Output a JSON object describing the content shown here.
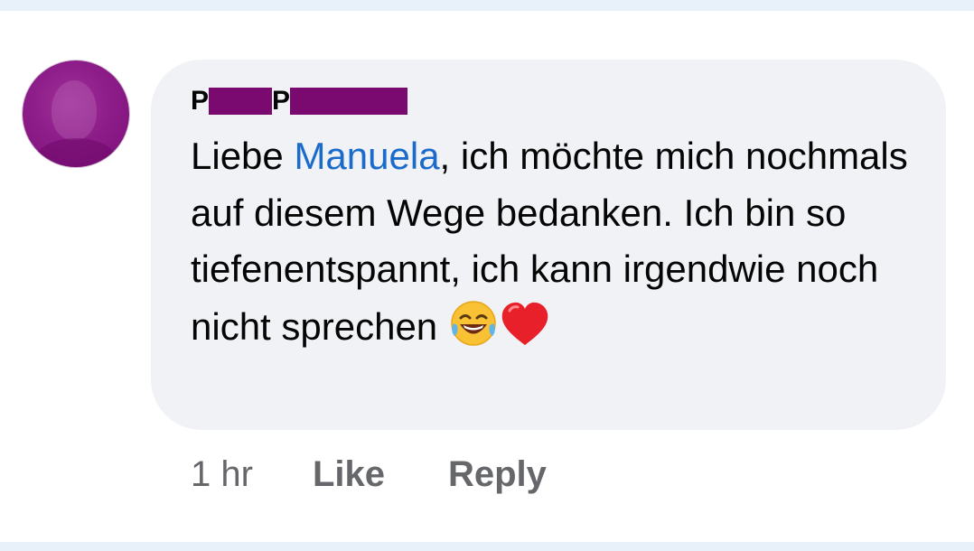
{
  "comment": {
    "author_initial_1": "P",
    "author_initial_2": "P",
    "text_before_mention": "Liebe ",
    "mention": "Manuela",
    "text_after_mention": ", ich möchte mich nochmals auf diesem Wege bedanken. Ich bin so tiefenentspannt, ich kann irgendwie noch nicht sprechen ",
    "emojis": [
      "laughing-with-tears-emoji",
      "red-heart-emoji"
    ]
  },
  "actions": {
    "time": "1 hr",
    "like_label": "Like",
    "reply_label": "Reply"
  },
  "colors": {
    "bubble": "#f0f2f5",
    "mention": "#1b6bcb",
    "redaction": "#7a0a6f",
    "meta_text": "#65676b",
    "avatar": "#8d1d89"
  }
}
